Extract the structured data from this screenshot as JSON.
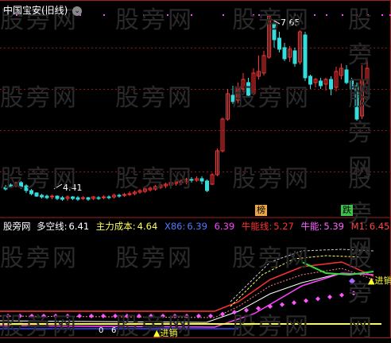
{
  "header": {
    "title": "中国宝安(旧线)"
  },
  "price_panel": {
    "high_label": "7.65",
    "low_label": "4.41",
    "tags": [
      {
        "label": "榜",
        "color": "#e8a84a"
      },
      {
        "label": "跌",
        "color": "#3cc24a"
      }
    ]
  },
  "indicator_panel": {
    "name": "股旁网",
    "legend": [
      {
        "label": "多空线:",
        "value": "6.41",
        "color": "#ffffff"
      },
      {
        "label": "主力成本:",
        "value": "4.64",
        "color": "#ffff55"
      },
      {
        "label": "X86:",
        "value": "6.39",
        "color": "#5577ff"
      },
      {
        "label": "",
        "value": "6.39",
        "color": "#ff44ff"
      },
      {
        "label": "牛能线:",
        "value": "5.27",
        "color": "#ff3333"
      },
      {
        "label": "牛能:",
        "value": "5.39",
        "color": "#ff66ff"
      },
      {
        "label": "M1:",
        "value": "6.45",
        "color": "#ff4444"
      }
    ],
    "signals": [
      {
        "label": "进销",
        "color": "#ffff33"
      },
      {
        "label": "进销",
        "color": "#ffff33"
      }
    ],
    "bottom_labels": [
      "0",
      "6"
    ]
  },
  "watermark": "股旁网",
  "colors": {
    "up": "#ff3333",
    "down": "#33dddd",
    "grid": "#8a1a1a"
  }
}
